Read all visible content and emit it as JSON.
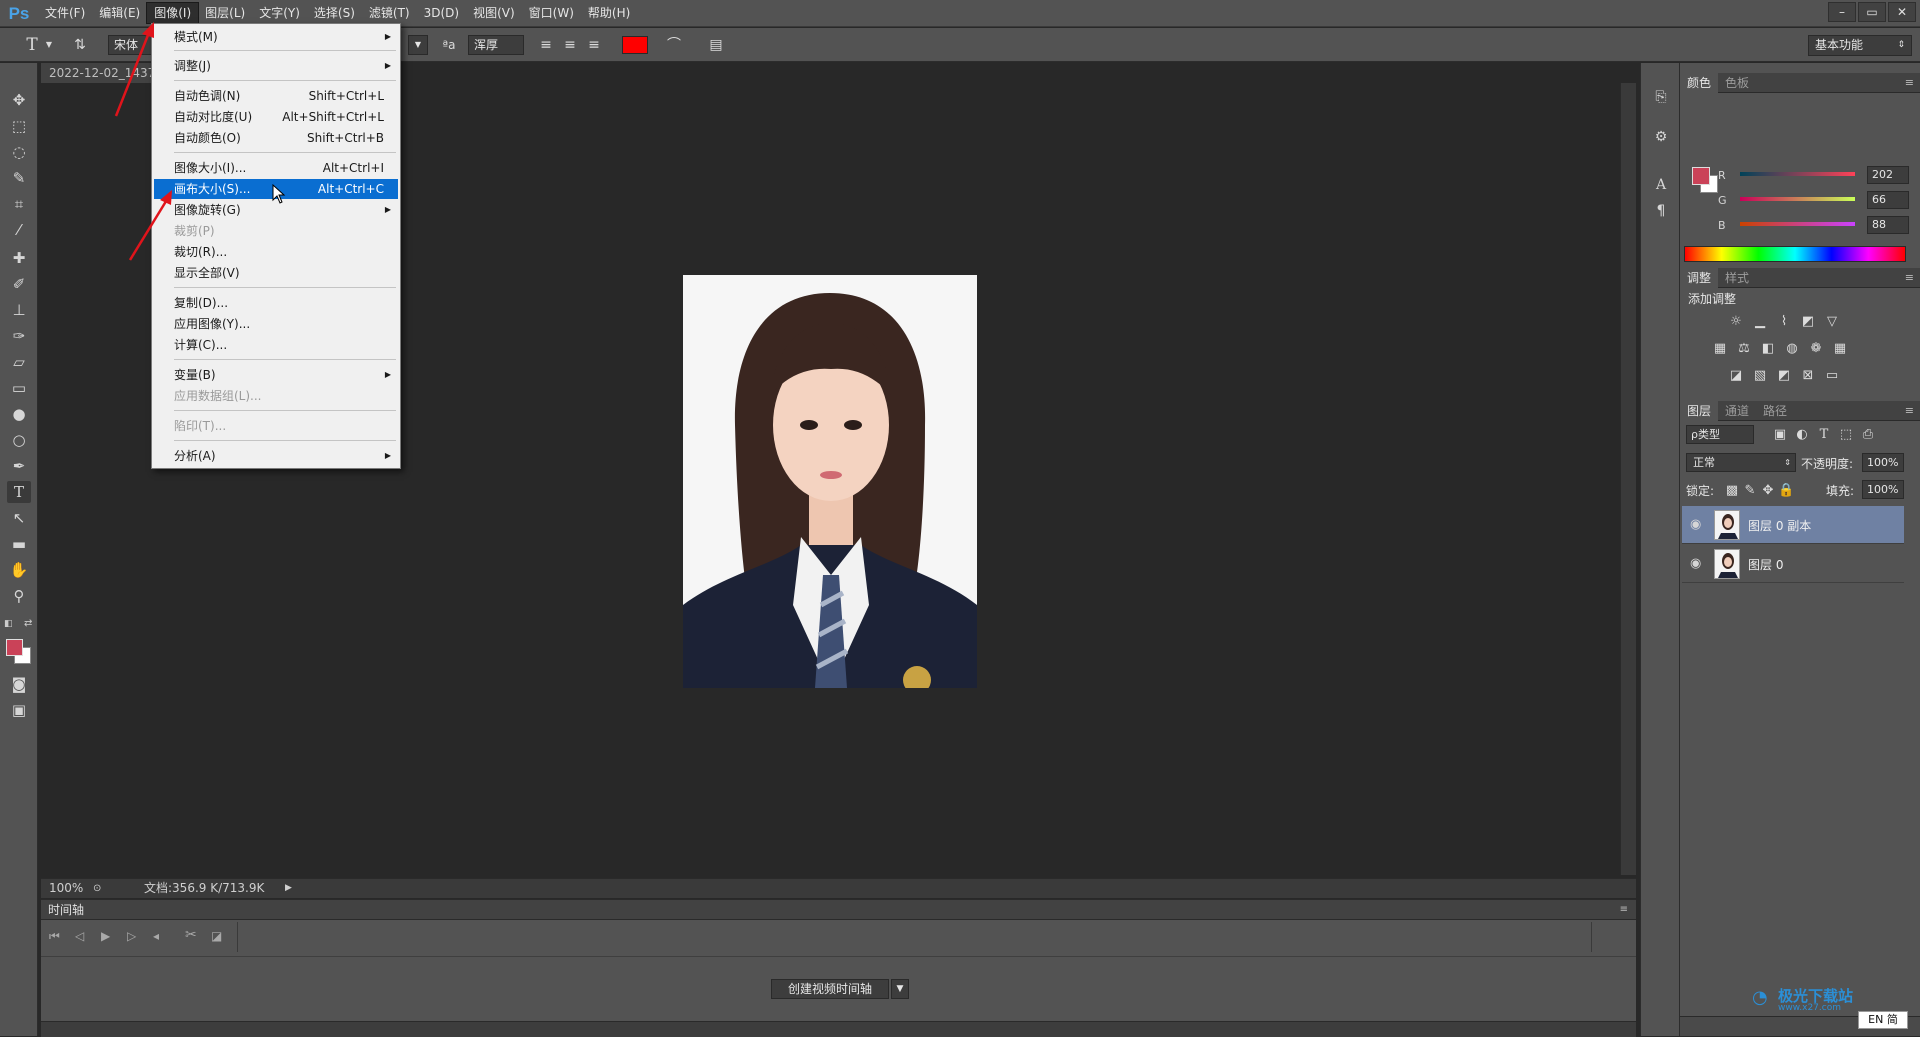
{
  "app": {
    "logo": "Ps"
  },
  "menubar": {
    "items": [
      "文件(F)",
      "编辑(E)",
      "图像(I)",
      "图层(L)",
      "文字(Y)",
      "选择(S)",
      "滤镜(T)",
      "3D(D)",
      "视图(V)",
      "窗口(W)",
      "帮助(H)"
    ],
    "active_index": 2,
    "window_buttons": [
      "–",
      "▭",
      "✕"
    ]
  },
  "options": {
    "tool_letter": "T",
    "font_family": "宋体",
    "aa_label": "ªa",
    "antialias": "浑厚",
    "text_color": "#ff0000"
  },
  "workspace": {
    "label": "基本功能"
  },
  "document": {
    "tab_title": "2022-12-02_1437",
    "zoom": "100%",
    "doc_info": "文档:356.9 K/713.9K"
  },
  "timeline": {
    "title": "时间轴",
    "create_button": "创建视频时间轴",
    "dropdown": "▼"
  },
  "image_menu": {
    "items": [
      {
        "label": "模式(M)",
        "shortcut": "",
        "submenu": true,
        "disabled": false
      },
      {
        "label": "调整(J)",
        "shortcut": "",
        "submenu": true,
        "disabled": false
      },
      {
        "label": "自动色调(N)",
        "shortcut": "Shift+Ctrl+L",
        "submenu": false,
        "disabled": false
      },
      {
        "label": "自动对比度(U)",
        "shortcut": "Alt+Shift+Ctrl+L",
        "submenu": false,
        "disabled": false
      },
      {
        "label": "自动颜色(O)",
        "shortcut": "Shift+Ctrl+B",
        "submenu": false,
        "disabled": false
      },
      {
        "label": "图像大小(I)...",
        "shortcut": "Alt+Ctrl+I",
        "submenu": false,
        "disabled": false
      },
      {
        "label": "画布大小(S)...",
        "shortcut": "Alt+Ctrl+C",
        "submenu": false,
        "disabled": false,
        "highlighted": true
      },
      {
        "label": "图像旋转(G)",
        "shortcut": "",
        "submenu": true,
        "disabled": false
      },
      {
        "label": "裁剪(P)",
        "shortcut": "",
        "submenu": false,
        "disabled": true
      },
      {
        "label": "裁切(R)...",
        "shortcut": "",
        "submenu": false,
        "disabled": false
      },
      {
        "label": "显示全部(V)",
        "shortcut": "",
        "submenu": false,
        "disabled": false
      },
      {
        "label": "复制(D)...",
        "shortcut": "",
        "submenu": false,
        "disabled": false
      },
      {
        "label": "应用图像(Y)...",
        "shortcut": "",
        "submenu": false,
        "disabled": false
      },
      {
        "label": "计算(C)...",
        "shortcut": "",
        "submenu": false,
        "disabled": false
      },
      {
        "label": "变量(B)",
        "shortcut": "",
        "submenu": true,
        "disabled": false
      },
      {
        "label": "应用数据组(L)...",
        "shortcut": "",
        "submenu": false,
        "disabled": true
      },
      {
        "label": "陷印(T)...",
        "shortcut": "",
        "submenu": false,
        "disabled": true
      },
      {
        "label": "分析(A)",
        "shortcut": "",
        "submenu": true,
        "disabled": false
      }
    ]
  },
  "color_panel": {
    "tabs": [
      "颜色",
      "色板"
    ],
    "foreground": "#ca4258",
    "background": "#ffffff",
    "channels": [
      {
        "name": "R",
        "value": "202"
      },
      {
        "name": "G",
        "value": "66"
      },
      {
        "name": "B",
        "value": "88"
      }
    ]
  },
  "adjust_panel": {
    "tabs": [
      "调整",
      "样式"
    ],
    "title": "添加调整"
  },
  "layers_panel": {
    "tabs": [
      "图层",
      "通道",
      "路径"
    ],
    "filter_label": "ρ类型",
    "blend_mode": "正常",
    "opacity_label": "不透明度:",
    "opacity": "100%",
    "lock_label": "锁定:",
    "fill_label": "填充:",
    "fill": "100%",
    "layers": [
      {
        "name": "图层 0 副本",
        "selected": true
      },
      {
        "name": "图层 0",
        "selected": false
      }
    ]
  },
  "watermark": {
    "site": "极光下载站",
    "url": "www.x27.com",
    "ime": "EN 简"
  }
}
